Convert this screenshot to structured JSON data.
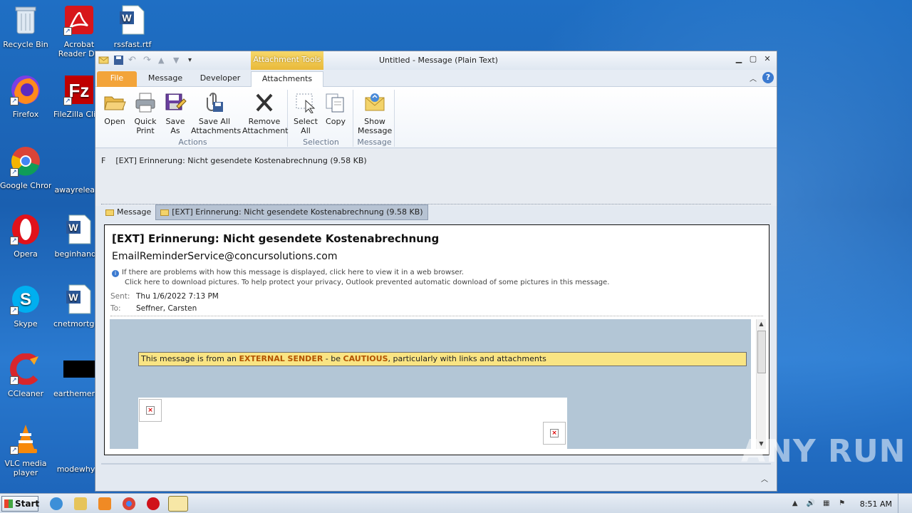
{
  "desktop": {
    "icons": [
      {
        "label": "Recycle Bin"
      },
      {
        "label": "Acrobat Reader DC"
      },
      {
        "label": "rssfast.rtf"
      },
      {
        "label": "Firefox"
      },
      {
        "label": "FileZilla Client"
      },
      {
        "label": "Google Chrome"
      },
      {
        "label": "awayrelease"
      },
      {
        "label": "Opera"
      },
      {
        "label": "beginhand..."
      },
      {
        "label": "Skype"
      },
      {
        "label": "cnetmortga..."
      },
      {
        "label": "CCleaner"
      },
      {
        "label": "earthemerg..."
      },
      {
        "label": "VLC media player"
      },
      {
        "label": "modewhy..."
      }
    ],
    "watermark": "ANY RUN"
  },
  "window": {
    "title": "Untitled -  Message (Plain Text)",
    "context_tab": "Attachment Tools",
    "tabs": [
      "File",
      "Message",
      "Developer",
      "Attachments"
    ],
    "active_tab": "Attachments",
    "ribbon": {
      "actions": {
        "group_label": "Actions",
        "buttons": [
          "Open",
          "Quick Print",
          "Save As",
          "Save All Attachments",
          "Remove Attachment"
        ]
      },
      "selection": {
        "group_label": "Selection",
        "buttons": [
          "Select All",
          "Copy"
        ]
      },
      "message": {
        "group_label": "Message",
        "buttons": [
          "Show Message"
        ]
      }
    },
    "attachment": {
      "prefix": "F",
      "name": "[EXT] Erinnerung: Nicht gesendete Kostenabrechnung (9.58 KB)"
    },
    "message_tabs": [
      "Message",
      "[EXT] Erinnerung: Nicht gesendete Kostenabrechnung (9.58 KB)"
    ],
    "message": {
      "subject": "[EXT] Erinnerung: Nicht gesendete Kostenabrechnung",
      "from": "EmailReminderService@concursolutions.com",
      "info_line1": "If there are problems with how this message is displayed, click here to view it in a web browser.",
      "info_line2": "Click here to download pictures. To help protect your privacy, Outlook prevented automatic download of some pictures in this message.",
      "sent_label": "Sent:",
      "sent_value": "Thu 1/6/2022 7:13 PM",
      "to_label": "To:",
      "to_value": "Seffner, Carsten",
      "banner_pre": "This message is from an ",
      "banner_ext": "EXTERNAL SENDER",
      "banner_mid": " - be ",
      "banner_caut": "CAUTIOUS",
      "banner_post": ", particularly with links and attachments"
    }
  },
  "taskbar": {
    "start_label": "Start",
    "clock": "8:51 AM"
  }
}
